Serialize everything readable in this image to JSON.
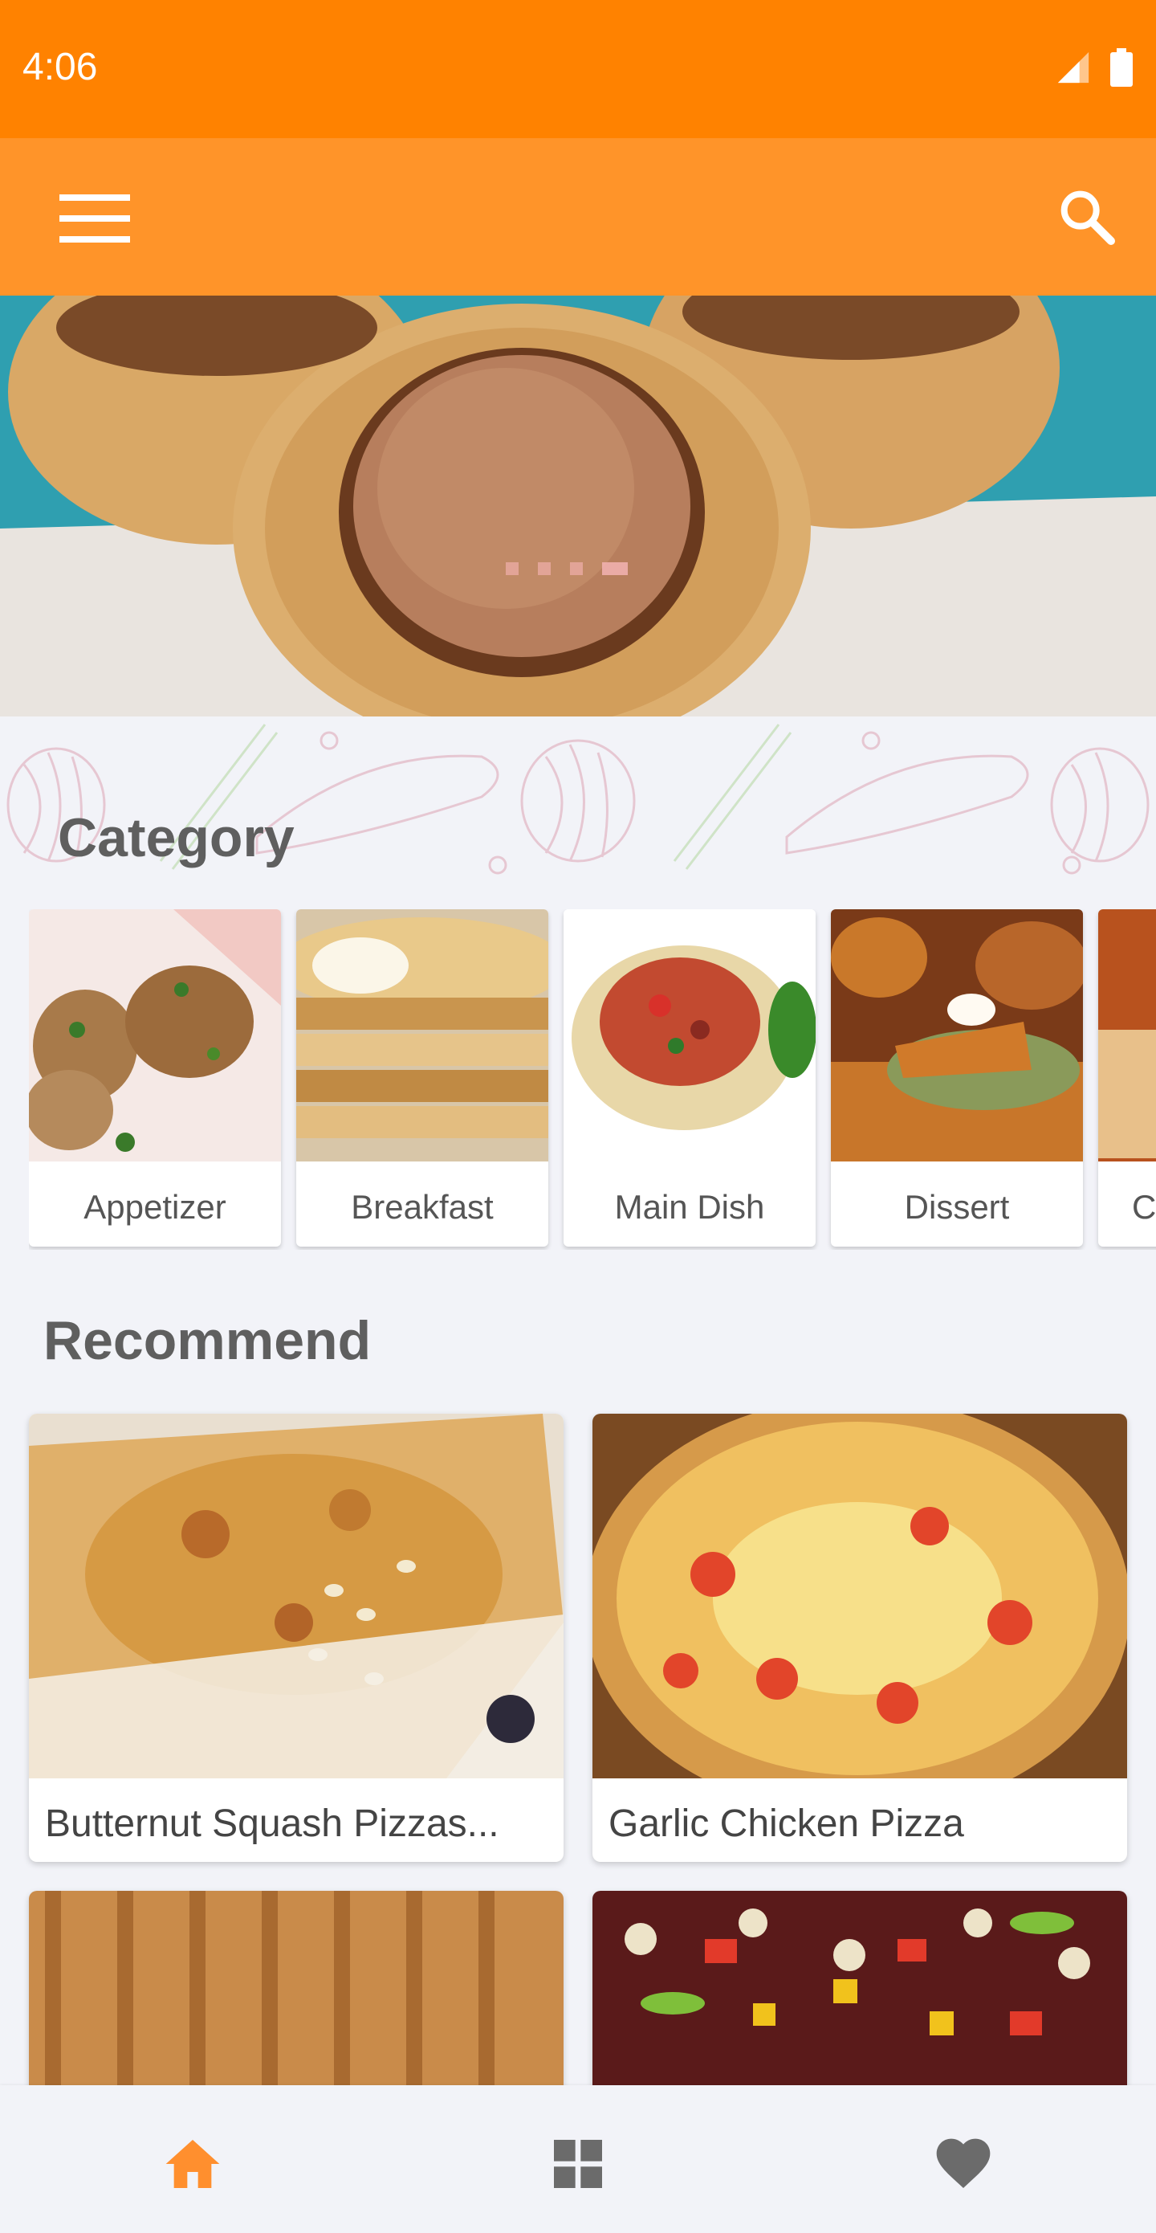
{
  "status_bar": {
    "time": "4:06",
    "icons": [
      "signal-icon",
      "battery-icon"
    ]
  },
  "app_bar": {
    "menu_icon": "hamburger-menu-icon",
    "search_icon": "search-icon",
    "color": "#ff9429"
  },
  "hero": {
    "image": "peanut-butter-cup-cookies",
    "slides": 4,
    "active_slide": 4
  },
  "category": {
    "title": "Category",
    "items": [
      {
        "label": "Appetizer",
        "image": "stuffed-mushrooms"
      },
      {
        "label": "Breakfast",
        "image": "pancakes"
      },
      {
        "label": "Main Dish",
        "image": "spaghetti"
      },
      {
        "label": "Dissert",
        "image": "pumpkin-pie"
      },
      {
        "label": "C",
        "image": "crackers"
      }
    ]
  },
  "recommend": {
    "title": "Recommend",
    "items": [
      {
        "label": "Butternut Squash Pizzas...",
        "image": "squash-pizza"
      },
      {
        "label": "Garlic Chicken Pizza",
        "image": "garlic-chicken-pizza"
      },
      {
        "label": "",
        "image": "bread-loaf"
      },
      {
        "label": "",
        "image": "bean-salad"
      }
    ]
  },
  "bottom_nav": {
    "items": [
      {
        "icon": "home-icon",
        "active": true
      },
      {
        "icon": "grid-icon",
        "active": false
      },
      {
        "icon": "heart-icon",
        "active": false
      }
    ],
    "active_color": "#ff8f2e",
    "inactive_color": "#6b6b6b"
  }
}
